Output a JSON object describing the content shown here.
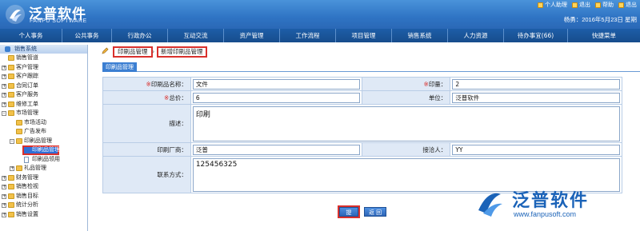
{
  "header": {
    "logo_cn": "泛普软件",
    "logo_en": "FANPU SOFTWARE",
    "top_links": [
      "个人助理",
      "退出",
      "帮助",
      "退出"
    ],
    "user_line": "杨勇：2016年5月23日 星期"
  },
  "nav": {
    "items": [
      "个人事务",
      "公共事务",
      "行政办公",
      "互动交流",
      "资产管理",
      "工作流程",
      "项目管理",
      "销售系统",
      "人力资源",
      "待办事宜(66)",
      "快捷菜单"
    ]
  },
  "sidebar": {
    "title": "销售系统",
    "items": [
      {
        "label": "销售管道",
        "level": 1,
        "pm": ""
      },
      {
        "label": "客户管理",
        "level": 1,
        "pm": "+"
      },
      {
        "label": "客户跟踪",
        "level": 1,
        "pm": "+"
      },
      {
        "label": "合同订单",
        "level": 1,
        "pm": "+"
      },
      {
        "label": "客户服务",
        "level": 1,
        "pm": "+"
      },
      {
        "label": "维修工单",
        "level": 1,
        "pm": "+"
      },
      {
        "label": "市场管理",
        "level": 1,
        "pm": "-"
      },
      {
        "label": "市场活动",
        "level": 2,
        "pm": ""
      },
      {
        "label": "广告发布",
        "level": 2,
        "pm": ""
      },
      {
        "label": "印刷品管理",
        "level": 2,
        "pm": "-"
      },
      {
        "label": "印刷品管理",
        "level": 3,
        "pm": "",
        "selected": true
      },
      {
        "label": "印刷品领用",
        "level": 3,
        "pm": ""
      },
      {
        "label": "礼品管理",
        "level": 2,
        "pm": "+"
      },
      {
        "label": "财务管理",
        "level": 1,
        "pm": "+"
      },
      {
        "label": "销售检视",
        "level": 1,
        "pm": "+"
      },
      {
        "label": "销售目标",
        "level": 1,
        "pm": "+"
      },
      {
        "label": "统计分析",
        "level": 1,
        "pm": "+"
      },
      {
        "label": "销售设置",
        "level": 1,
        "pm": "+"
      }
    ]
  },
  "breadcrumb": {
    "first": "印刷品管理",
    "second": "新增印刷品管理"
  },
  "tab_label": "印刷品管理",
  "form": {
    "name_label": "印刷品名称：",
    "name_value": "文件",
    "qty_label": "印量：",
    "qty_value": "2",
    "price_label": "总价：",
    "price_value": "6",
    "unit_label": "单位：",
    "unit_value": "泛普软件",
    "desc_label": "描述：",
    "desc_value": "印刷",
    "maker_label": "印刷厂商：",
    "maker_value": "泛普",
    "contact_label": "接洽人：",
    "contact_value": "YY",
    "phone_label": "联系方式：",
    "phone_value": "125456325"
  },
  "buttons": {
    "submit": "提 交",
    "back": "返 回"
  },
  "watermark": {
    "name": "泛普软件",
    "url": "www.fanpusoft.com"
  },
  "colors": {
    "header_blue": "#2f74c4",
    "nav_blue": "#1d5ea8",
    "highlight_red": "#d9302c",
    "label_bg": "#dfe9f6"
  }
}
